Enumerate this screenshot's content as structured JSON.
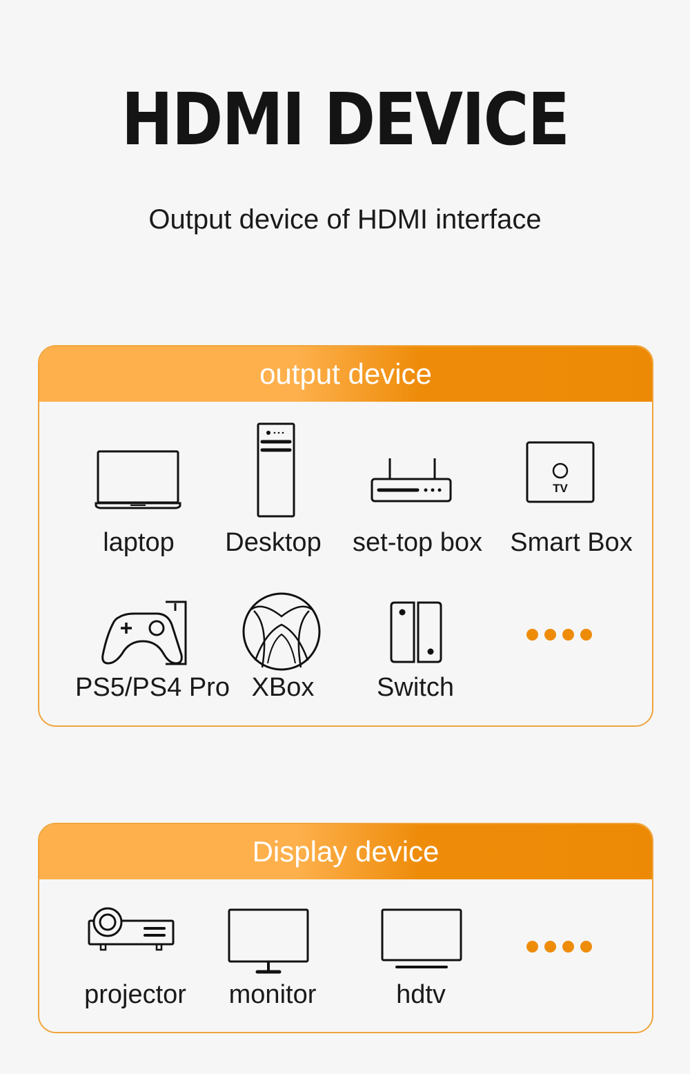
{
  "header": {
    "title": "HDMI DEVICE",
    "subtitle": "Output device of HDMI interface"
  },
  "theme": {
    "accent": "#ee8c0a",
    "accent_light": "#fdb04c",
    "border": "#f0a43a",
    "background": "#f6f6f6"
  },
  "output_section": {
    "title": "output device",
    "items": [
      {
        "label": "laptop",
        "icon": "laptop-icon"
      },
      {
        "label": "Desktop",
        "icon": "desktop-tower-icon"
      },
      {
        "label": "set-top box",
        "icon": "set-top-box-icon"
      },
      {
        "label": "Smart Box",
        "icon": "smart-tv-box-icon"
      },
      {
        "label": "PS5/PS4 Pro",
        "icon": "game-controller-icon"
      },
      {
        "label": "XBox",
        "icon": "xbox-logo-icon"
      },
      {
        "label": "Switch",
        "icon": "nintendo-switch-icon"
      },
      {
        "label": "",
        "icon": "more-dots-icon"
      }
    ]
  },
  "display_section": {
    "title": "Display device",
    "items": [
      {
        "label": "projector",
        "icon": "projector-icon"
      },
      {
        "label": "monitor",
        "icon": "monitor-icon"
      },
      {
        "label": "hdtv",
        "icon": "hdtv-icon"
      },
      {
        "label": "",
        "icon": "more-dots-icon"
      }
    ]
  },
  "tv_badge_text": "TV"
}
